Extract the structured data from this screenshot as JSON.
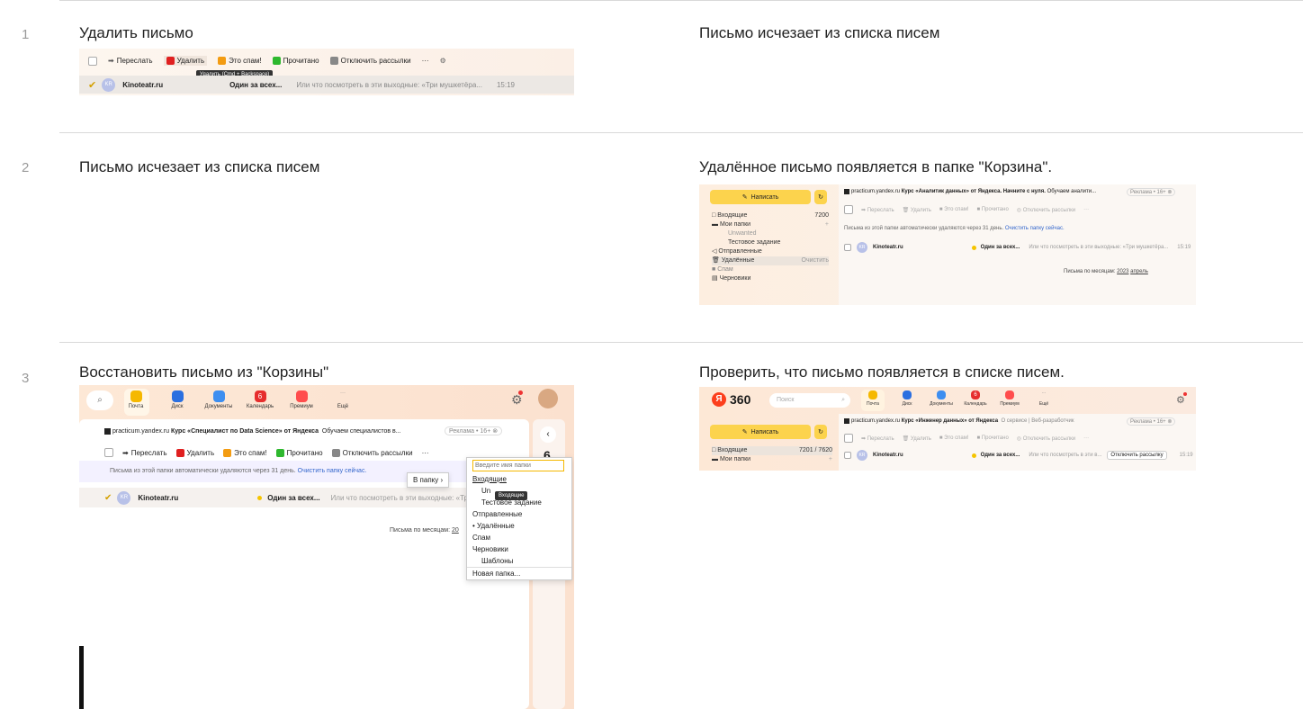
{
  "rows": [
    {
      "num": "1",
      "left": "Удалить письмо",
      "right": "Письмо исчезает из списка писем"
    },
    {
      "num": "2",
      "left": "Письмо исчезает из списка писем",
      "right": "Удалённое письмо появляется в папке \"Корзина\"."
    },
    {
      "num": "3",
      "left": "Восстановить письмо из \"Корзины\"",
      "right": "Проверить, что письмо появляется в списке писем."
    }
  ],
  "toolbar": {
    "forward": "Переслать",
    "delete": "Удалить",
    "spam": "Это спам!",
    "read": "Прочитано",
    "unsub": "Отключить рассылки",
    "more": "···"
  },
  "tooltip_delete": "Удалить (Cmd + Backspace)",
  "mail": {
    "avatar": "KR",
    "sender": "Kinoteatr.ru",
    "subject": "Один за всех...",
    "preview": "Или что посмотреть в эти выходные: «Три мушкетёра...",
    "time": "15:19",
    "preview_short": "Или что посмотреть в эти в...",
    "unsub_btn": "Отключить рассылку"
  },
  "notice": "Письма из этой папки автоматически удаляются через 31 день.",
  "notice_link": "Очистить папку сейчас.",
  "ad1": {
    "domain": "practicum.yandex.ru",
    "title": "Курс «Аналитик данных» от Яндекса. Начните с нуля.",
    "desc": "Обучаем аналити...",
    "label": "Реклама • 16+ ⊗"
  },
  "ad2": {
    "domain": "practicum.yandex.ru",
    "title": "Курс «Специалист по Data Science» от Яндекса",
    "desc": "Обучаем специалистов в...",
    "label": "Реклама • 16+ ⊗"
  },
  "ad3": {
    "domain": "practicum.yandex.ru",
    "title": "Курс «Инженер данных» от Яндекса",
    "desc": "О сервисе | Веб-разработчик",
    "label": "Реклама • 16+ ⊗"
  },
  "sidebar": {
    "compose": "Написать",
    "inbox": "Входящие",
    "inbox_count": "7200",
    "inbox_count2": "7201 / 7620",
    "myfolders": "Мои папки",
    "unwanted": "Unwanted",
    "test": "Тестовое задание",
    "sent": "Отправленные",
    "deleted": "Удалённые",
    "clear": "Очистить",
    "spam": "Спам",
    "drafts": "Черновики"
  },
  "months": {
    "label": "Письма по месяцам:",
    "year": "2023",
    "month": "апрель",
    "year_cut": "20"
  },
  "apps": [
    "Почта",
    "Диск",
    "Документы",
    "Календарь",
    "Премиум",
    "Ещё"
  ],
  "apps_badge": "6",
  "logo": "360",
  "search": "Поиск",
  "move": {
    "label": "В папку",
    "placeholder": "Введите имя папки",
    "items": [
      "Входящие",
      "Un",
      "Тестовое задание",
      "Отправленные",
      "• Удалённые",
      "Спам",
      "Черновики",
      "Шаблоны"
    ],
    "new": "Новая папка...",
    "tip": "Входящие"
  },
  "side_num": "6"
}
